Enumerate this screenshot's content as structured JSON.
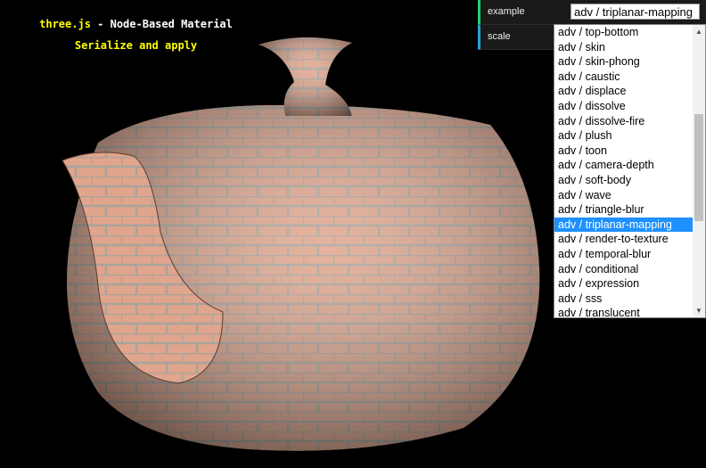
{
  "info": {
    "brand": "three.js",
    "title": " - Node-Based Material",
    "subtitle": "Serialize and apply"
  },
  "gui": {
    "example_label": "example",
    "scale_label": "scale",
    "example_value": "adv / triplanar-mapping"
  },
  "dropdown": {
    "selected_index": 13,
    "options": [
      "adv / top-bottom",
      "adv / skin",
      "adv / skin-phong",
      "adv / caustic",
      "adv / displace",
      "adv / dissolve",
      "adv / dissolve-fire",
      "adv / plush",
      "adv / toon",
      "adv / camera-depth",
      "adv / soft-body",
      "adv / wave",
      "adv / triangle-blur",
      "adv / triplanar-mapping",
      "adv / render-to-texture",
      "adv / temporal-blur",
      "adv / conditional",
      "adv / expression",
      "adv / sss",
      "adv / translucent"
    ]
  },
  "colors": {
    "accent_example": "#1ed36f",
    "accent_scale": "#2fa1d6",
    "highlight": "#1e90ff"
  }
}
